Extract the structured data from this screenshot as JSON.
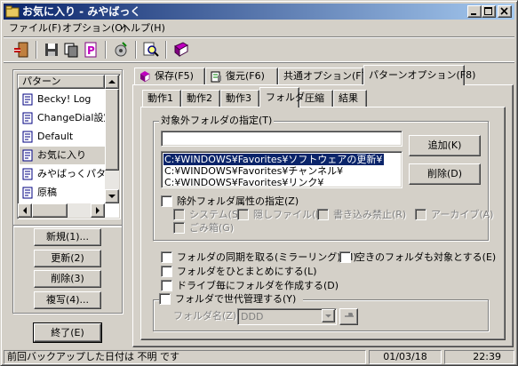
{
  "window": {
    "title": "お気に入り - みやばっく"
  },
  "menu": [
    "ファイル(F)",
    "オプション(O)",
    "ヘルプ(H)"
  ],
  "toolbar": {
    "icons": [
      "exit-icon",
      "save-icon",
      "copy-icon",
      "compressed-file-icon",
      "settings-icon",
      "search-icon",
      "book-icon"
    ]
  },
  "patterns": {
    "header": "パターン",
    "items": [
      {
        "label": "Becky! Log"
      },
      {
        "label": "ChangeDial設定"
      },
      {
        "label": "Default"
      },
      {
        "label": "お気に入り"
      },
      {
        "label": "みやばっくパタ"
      },
      {
        "label": "原稿"
      }
    ],
    "selected_index": 3
  },
  "side_buttons": {
    "new": "新規(1)...",
    "update": "更新(2)",
    "delete": "削除(3)",
    "copy": "複写(4)...",
    "exit": "終了(E)"
  },
  "main_tabs": [
    "保存(F5)",
    "復元(F6)",
    "共通オプション(F7)",
    "パターンオプション(F8)"
  ],
  "sub_tabs": [
    "動作1",
    "動作2",
    "動作3",
    "フォルダ",
    "圧縮",
    "結果"
  ],
  "folder_tab": {
    "exclude_group_label": "対象外フォルダの指定(T)",
    "input_value": "",
    "excluded_folders": [
      "C:¥WINDOWS¥Favorites¥ソフトウェアの更新¥",
      "C:¥WINDOWS¥Favorites¥チャンネル¥",
      "C:¥WINDOWS¥Favorites¥リンク¥"
    ],
    "add_button": "追加(K)",
    "delete_button": "削除(D)",
    "attr_check_label": "除外フォルダ属性の指定(Z)",
    "attributes": [
      "システム(S)",
      "隠しファイル(H)",
      "書き込み禁止(R)",
      "アーカイブ(A)",
      "ごみ箱(G)"
    ],
    "options": {
      "sync": "フォルダの同期を取る(ミラーリング)(M)",
      "include_empty": "空きのフォルダも対象とする(E)",
      "combine": "フォルダをひとまとめにする(L)",
      "per_drive": "ドライブ毎にフォルダを作成する(D)"
    },
    "generation_check": "フォルダで世代管理する(Y)",
    "folder_name_label": "フォルダ名(Z)",
    "folder_name_value": "DDD"
  },
  "status": {
    "message": "前回バックアップした日付は 不明 です",
    "date": "01/03/18",
    "time": "22:39"
  },
  "colors": {
    "title_start": "#0a246a",
    "title_end": "#a6caf0",
    "face": "#d4d0c8",
    "selection": "#0a246a"
  }
}
